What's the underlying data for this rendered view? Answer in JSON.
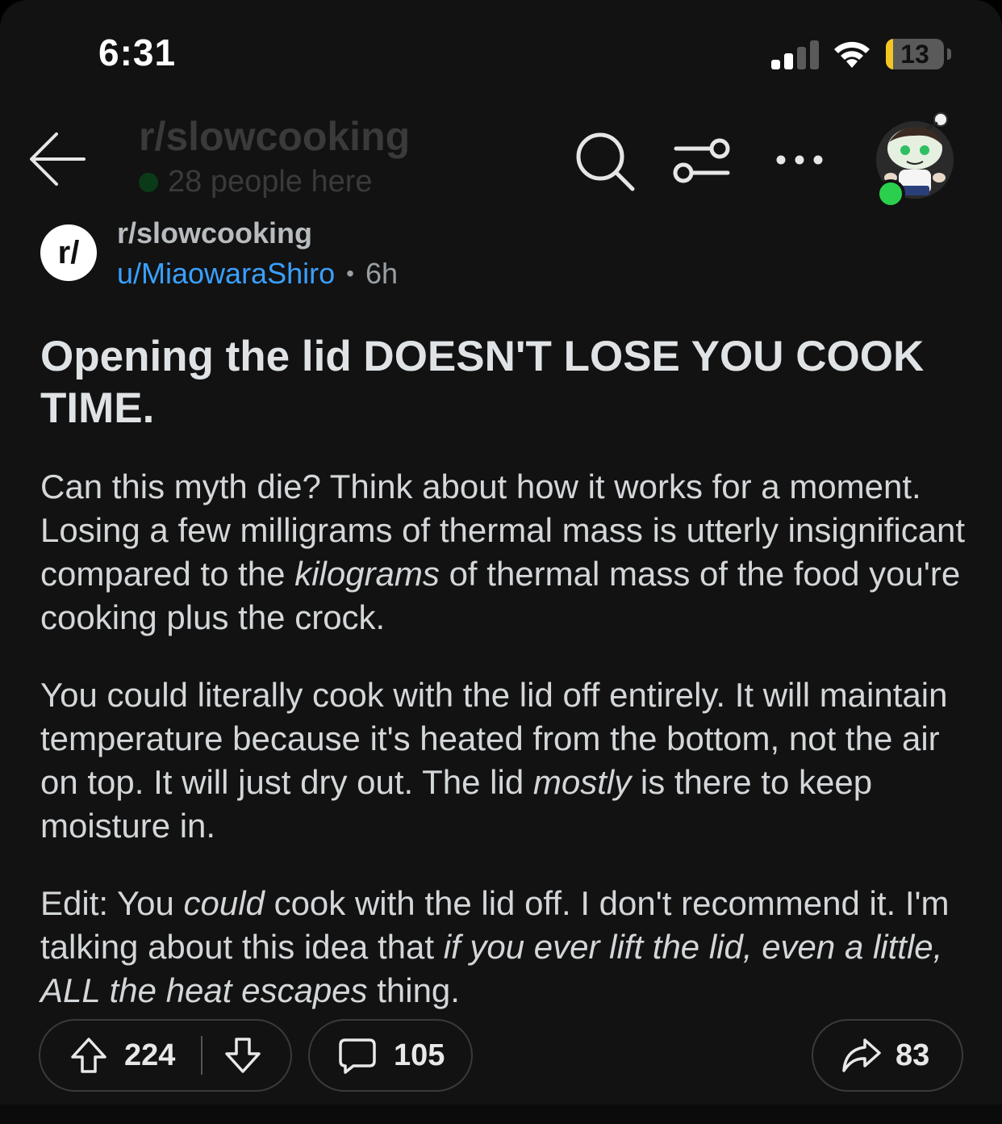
{
  "status_bar": {
    "time": "6:31",
    "battery_level": "13",
    "battery_fraction": 0.13,
    "signal_bars_active": 2,
    "signal_bars_total": 4
  },
  "header": {
    "subreddit_title": "r/slowcooking",
    "online_text": "28 people here",
    "icons": [
      "back-arrow-icon",
      "search-icon",
      "filter-icon",
      "more-icon"
    ]
  },
  "post": {
    "subreddit_icon_text": "r/",
    "subreddit": "r/slowcooking",
    "author": "u/MiaowaraShiro",
    "separator": "•",
    "age": "6h",
    "title": "Opening the lid DOESN'T LOSE YOU COOK TIME.",
    "paragraphs": [
      [
        {
          "text": "Can this myth die? Think about how it works for a moment. Losing a few milligrams of thermal mass is utterly insignificant compared to the ",
          "italic": false
        },
        {
          "text": "kilograms",
          "italic": true
        },
        {
          "text": " of thermal mass of the food you're cooking plus the crock.",
          "italic": false
        }
      ],
      [
        {
          "text": "You could literally cook with the lid off entirely. It will maintain temperature because it's heated from the bottom, not the air on top. It will just dry out. The lid ",
          "italic": false
        },
        {
          "text": "mostly",
          "italic": true
        },
        {
          "text": " is there to keep moisture in.",
          "italic": false
        }
      ],
      [
        {
          "text": "Edit: You ",
          "italic": false
        },
        {
          "text": "could",
          "italic": true
        },
        {
          "text": " cook with the lid off. I don't recommend it. I'm talking about this idea that ",
          "italic": false
        },
        {
          "text": "if you ever lift the lid, even a little, ALL the heat escapes",
          "italic": true
        },
        {
          "text": " thing.",
          "italic": false
        }
      ]
    ]
  },
  "actions": {
    "upvotes": "224",
    "comments": "105",
    "shares": "83"
  },
  "colors": {
    "background": "#121212",
    "author_link": "#3aa0ff",
    "online_dot": "#2bcf4e",
    "battery_fill": "#f3c623"
  }
}
